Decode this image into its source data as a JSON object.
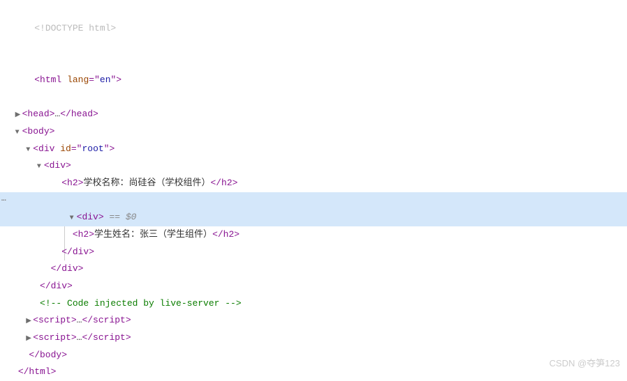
{
  "gutter_ellipsis": "…",
  "arrows": {
    "right": "▶",
    "down": "▼"
  },
  "doctype": "<!DOCTYPE html>",
  "lines": {
    "html_open": {
      "tag": "html",
      "attr_name": "lang",
      "attr_value": "en"
    },
    "head": {
      "open": "<head>",
      "ellipsis": "…",
      "close": "</head>"
    },
    "body_open": "<body>",
    "div_root": {
      "tag": "div",
      "attr_name": "id",
      "attr_value": "root"
    },
    "div_plain_open": "<div>",
    "h2_school": {
      "open": "<h2>",
      "text": "学校名称：尚硅谷（学校组件）",
      "close": "</h2>"
    },
    "div_selected": {
      "open": "<div>",
      "marker": " == $0"
    },
    "h2_student": {
      "open": "<h2>",
      "text": "学生姓名：张三（学生组件）",
      "close": "</h2>"
    },
    "div_close": "</div>",
    "comment": "<!-- Code injected by live-server -->",
    "script": {
      "open": "<script>",
      "ellipsis": "…",
      "close": "</script>"
    },
    "body_close": "</body>",
    "html_close": "</html>"
  },
  "watermark": "CSDN @夺笋123"
}
